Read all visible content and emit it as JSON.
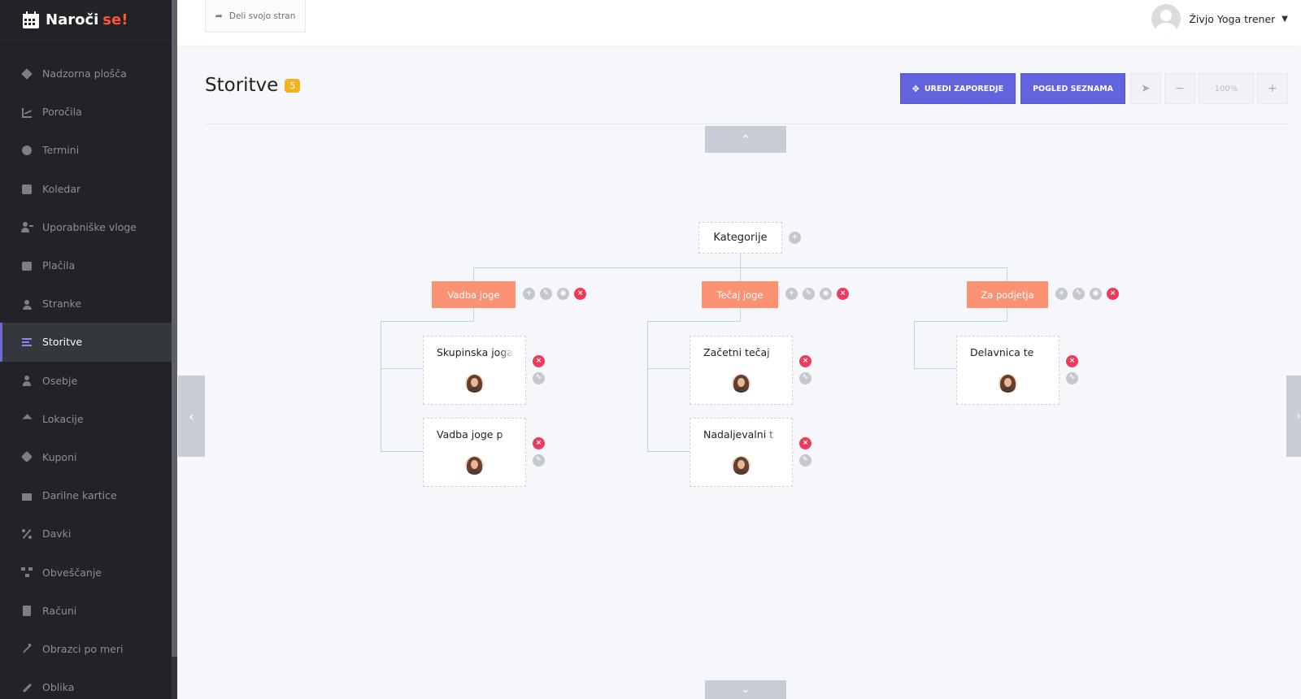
{
  "app": {
    "brand_name": "Naroči",
    "brand_accent": "se!",
    "accent_color": "#ff5533",
    "primary_color": "#6264de",
    "category_color": "#fa9273"
  },
  "sidebar": {
    "items": [
      {
        "label": "Nadzorna plošča",
        "icon": "cube-icon"
      },
      {
        "label": "Poročila",
        "icon": "chart-icon"
      },
      {
        "label": "Termini",
        "icon": "clock-icon"
      },
      {
        "label": "Koledar",
        "icon": "calendar-icon"
      },
      {
        "label": "Uporabniške vloge",
        "icon": "user-plus-icon"
      },
      {
        "label": "Plačila",
        "icon": "wallet-icon"
      },
      {
        "label": "Stranke",
        "icon": "users-icon"
      },
      {
        "label": "Storitve",
        "icon": "list-icon",
        "active": true
      },
      {
        "label": "Osebje",
        "icon": "user-icon"
      },
      {
        "label": "Lokacije",
        "icon": "location-arrow-icon"
      },
      {
        "label": "Kuponi",
        "icon": "tag-icon"
      },
      {
        "label": "Darilne kartice",
        "icon": "gift-icon"
      },
      {
        "label": "Davki",
        "icon": "percent-icon"
      },
      {
        "label": "Obveščanje",
        "icon": "network-icon"
      },
      {
        "label": "Računi",
        "icon": "invoice-icon"
      },
      {
        "label": "Obrazci po meri",
        "icon": "magic-icon"
      },
      {
        "label": "Oblika",
        "icon": "brush-icon"
      }
    ]
  },
  "topbar": {
    "share_label": "Deli svojo stran",
    "user_name": "Živjo Yoga trener"
  },
  "header": {
    "title": "Storitve",
    "count": "5"
  },
  "toolbar": {
    "edit_order_label": "UREDI ZAPOREDJE",
    "list_view_label": "POGLED SEZNAMA",
    "zoom_value": "100%"
  },
  "tree": {
    "root_label": "Kategorije",
    "categories": [
      {
        "label": "Vadba joge",
        "services": [
          "Skupinska joga",
          "Vadba joge p"
        ]
      },
      {
        "label": "Tečaj joge",
        "services": [
          "Začetni tečaj",
          "Nadaljevalni t"
        ]
      },
      {
        "label": "Za podjetja",
        "services": [
          "Delavnica te"
        ]
      }
    ]
  }
}
